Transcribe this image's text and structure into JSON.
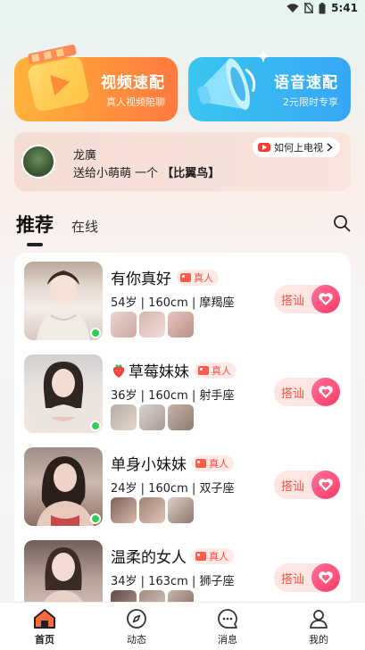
{
  "status_bar": {
    "time": "5:41"
  },
  "banners": {
    "video": {
      "title": "视频速配",
      "subtitle": "真人视频陪聊"
    },
    "voice": {
      "title": "语音速配",
      "subtitle": "2元限时专享"
    }
  },
  "notice": {
    "name": "龙廣",
    "text_prefix": "送给小萌萌 一个",
    "gift": "【比翼鸟】",
    "tv_link": "如何上电视"
  },
  "tabs": {
    "recommend": "推荐",
    "online": "在线"
  },
  "users": [
    {
      "name": "有你真好",
      "badge": "真人",
      "info": "54岁 | 160cm | 摩羯座",
      "greet": "搭讪",
      "online": true
    },
    {
      "name": "草莓妹妹",
      "badge": "真人",
      "info": "36岁 | 160cm | 射手座",
      "greet": "搭讪",
      "online": true,
      "prefix_icon": "strawberry-icon"
    },
    {
      "name": "单身小妹妹",
      "badge": "真人",
      "info": "24岁 | 160cm | 双子座",
      "greet": "搭讪",
      "online": true
    },
    {
      "name": "温柔的女人",
      "badge": "真人",
      "info": "34岁 | 163cm | 狮子座",
      "greet": "搭讪",
      "online": true
    }
  ],
  "nav": {
    "home": "首页",
    "moments": "动态",
    "messages": "消息",
    "mine": "我的"
  },
  "colors": {
    "accent": "#ff4a3e",
    "online": "#2fd04f",
    "video_banner": "#ff9a3c",
    "voice_banner": "#38b6f2"
  }
}
